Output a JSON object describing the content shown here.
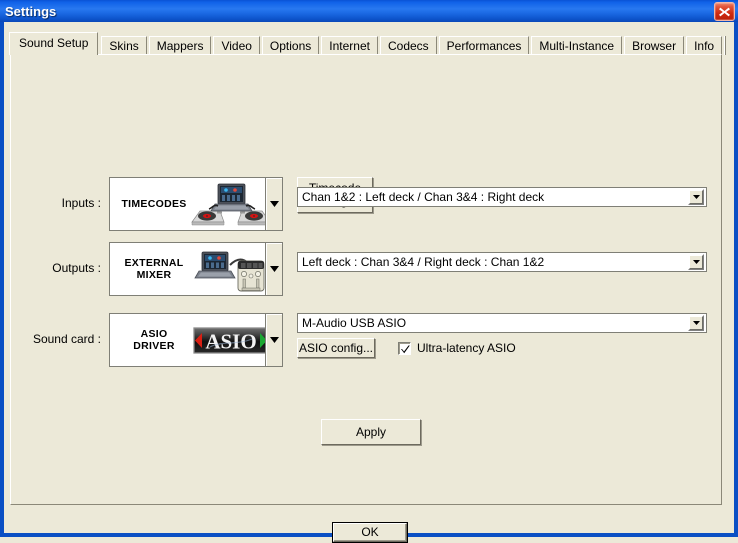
{
  "window": {
    "title": "Settings",
    "close_icon": "close-x-icon",
    "titlebar_color": "#1062e8",
    "client_color": "#ece9d8"
  },
  "tabs": [
    {
      "label": "Sound Setup",
      "active": true
    },
    {
      "label": "Skins",
      "active": false
    },
    {
      "label": "Mappers",
      "active": false
    },
    {
      "label": "Video",
      "active": false
    },
    {
      "label": "Options",
      "active": false
    },
    {
      "label": "Internet",
      "active": false
    },
    {
      "label": "Codecs",
      "active": false
    },
    {
      "label": "Performances",
      "active": false
    },
    {
      "label": "Multi-Instance",
      "active": false
    },
    {
      "label": "Browser",
      "active": false
    },
    {
      "label": "Info",
      "active": false
    }
  ],
  "sound_setup": {
    "inputs": {
      "label": "Inputs :",
      "picture_label": "TIMECODES",
      "picture_icon": "turntables-laptop-icon",
      "config_button": "Timecode\nConfig...",
      "channel_mapping": "Chan 1&2 : Left deck / Chan 3&4 : Right deck"
    },
    "outputs": {
      "label": "Outputs :",
      "picture_label": "EXTERNAL\nMIXER",
      "picture_icon": "laptop-mixer-icon",
      "channel_mapping": "Left deck : Chan 3&4 / Right deck : Chan 1&2"
    },
    "sound_card": {
      "label": "Sound card :",
      "picture_label": "ASIO\nDRIVER",
      "picture_icon": "asio-logo-icon",
      "driver": "M-Audio USB ASIO",
      "config_button": "ASIO config...",
      "ultra_latency_label": "Ultra-latency ASIO",
      "ultra_latency_checked": true
    },
    "apply_button": "Apply"
  },
  "footer": {
    "ok_button": "OK"
  }
}
